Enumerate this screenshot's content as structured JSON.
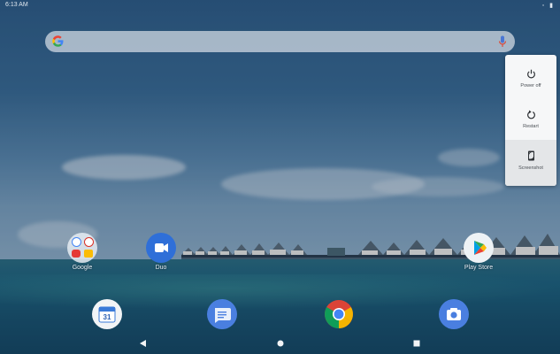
{
  "status_bar": {
    "time": "6:13 AM",
    "icons": "◦ ▮"
  },
  "search_bar": {
    "placeholder": ""
  },
  "home_apps": [
    {
      "label": "Google",
      "kind": "folder"
    },
    {
      "label": "Duo",
      "kind": "duo"
    },
    {
      "label": "Play Store",
      "kind": "play"
    }
  ],
  "dock": [
    {
      "name": "calendar",
      "text": "31"
    },
    {
      "name": "messages"
    },
    {
      "name": "chrome"
    },
    {
      "name": "camera"
    }
  ],
  "power_menu": {
    "items": [
      {
        "label": "Power off",
        "icon": "power-icon"
      },
      {
        "label": "Restart",
        "icon": "restart-icon"
      },
      {
        "label": "Screenshot",
        "icon": "screenshot-icon"
      }
    ]
  },
  "nav": {
    "back": "back",
    "home": "home",
    "recents": "recents"
  },
  "colors": {
    "menu_bg": "#f6f7f8",
    "menu_selected": "#e4e6e8",
    "scrim": "rgba(0,0,0,0.18)"
  }
}
